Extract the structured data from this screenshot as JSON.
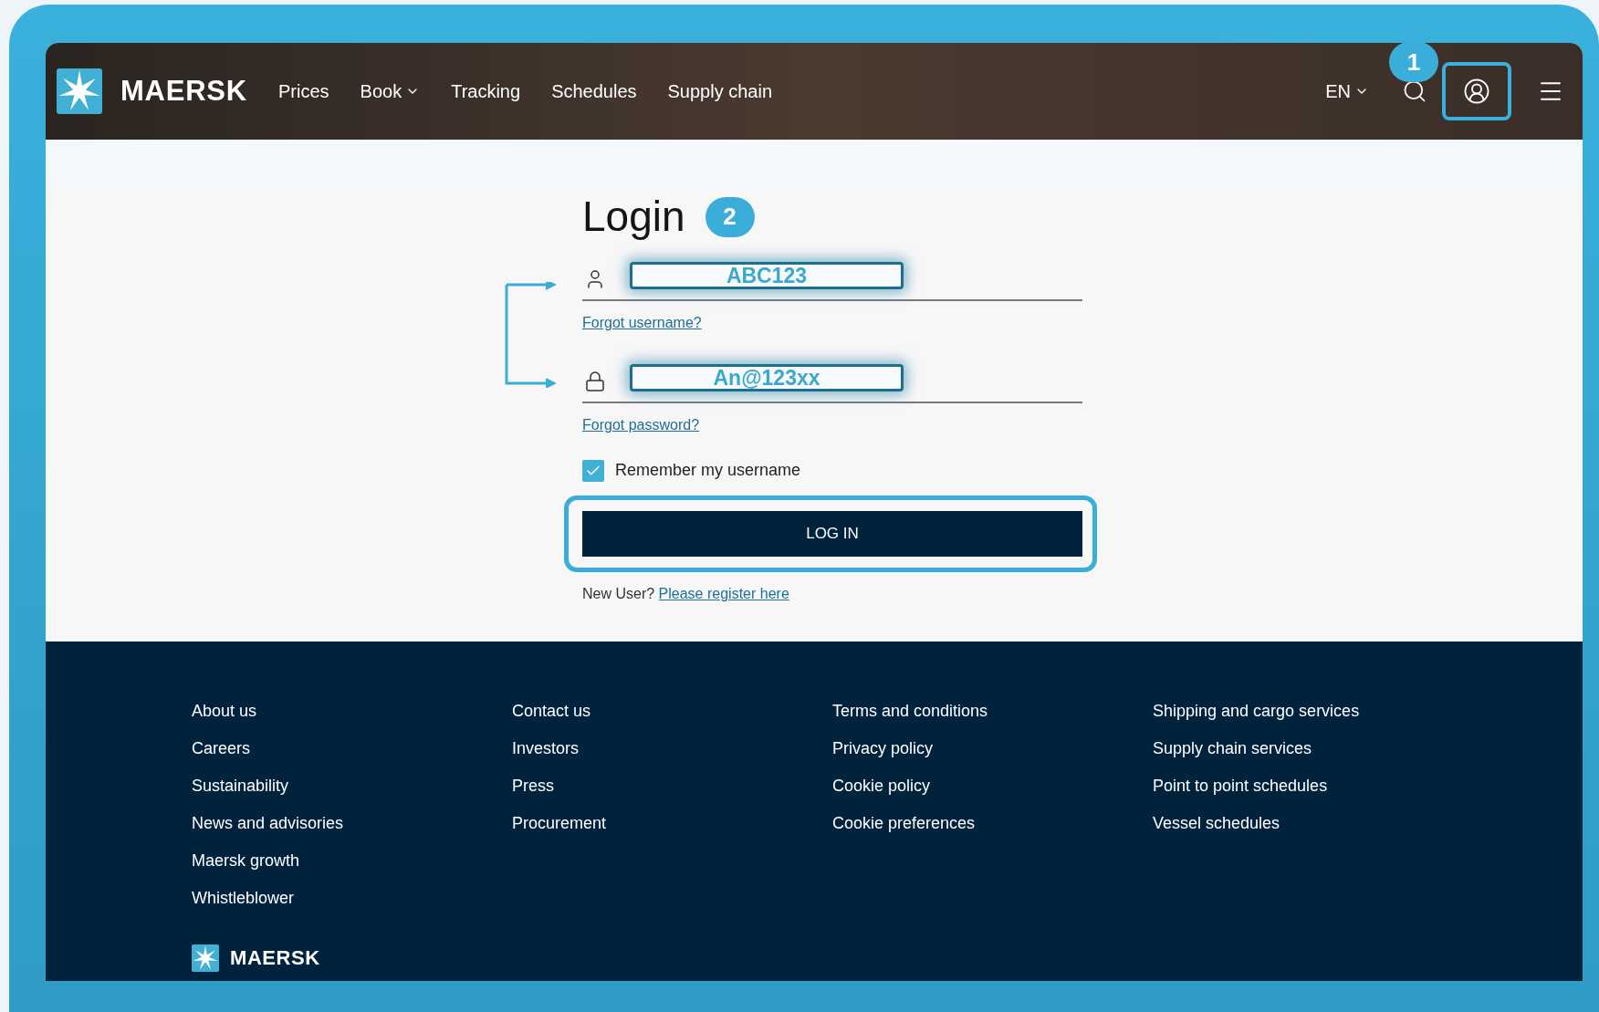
{
  "header": {
    "logo": "MAERSK",
    "nav": [
      {
        "label": "Prices",
        "dropdown": false
      },
      {
        "label": "Book",
        "dropdown": true
      },
      {
        "label": "Tracking",
        "dropdown": false
      },
      {
        "label": "Schedules",
        "dropdown": false
      },
      {
        "label": "Supply chain",
        "dropdown": false
      }
    ],
    "language": "EN",
    "account_highlighted": true,
    "account_badge": "1"
  },
  "login": {
    "title": "Login",
    "badge": "2",
    "fields": [
      {
        "kind": "username",
        "value": "ABC123",
        "link": "Forgot username?"
      },
      {
        "kind": "password",
        "value": "An@123xx",
        "link": "Forgot password?"
      }
    ],
    "remember": {
      "label": "Remember my username",
      "checked": true
    },
    "button": {
      "label": "LOG IN",
      "highlighted": true
    },
    "register_prompt": "New User?",
    "register_link": "Please register here"
  },
  "footer": {
    "columns": [
      [
        "About us",
        "Careers",
        "Sustainability",
        "News and advisories",
        "Maersk growth",
        "Whistleblower"
      ],
      [
        "Contact us",
        "Investors",
        "Press",
        "Procurement"
      ],
      [
        "Terms and conditions",
        "Privacy policy",
        "Cookie policy",
        "Cookie preferences"
      ],
      [
        "Shipping and cargo services",
        "Supply chain services",
        "Point to point schedules",
        "Vessel schedules"
      ]
    ],
    "logo": "MAERSK"
  }
}
